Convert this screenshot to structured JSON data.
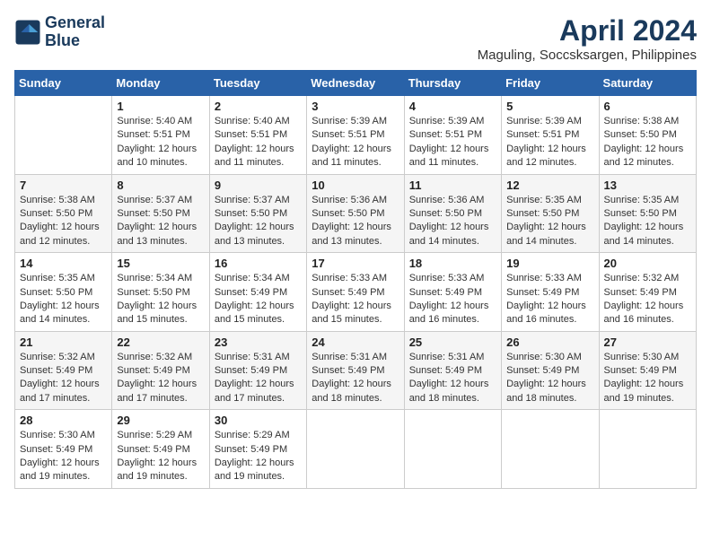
{
  "header": {
    "logo_line1": "General",
    "logo_line2": "Blue",
    "month_year": "April 2024",
    "location": "Maguling, Soccsksargen, Philippines"
  },
  "weekdays": [
    "Sunday",
    "Monday",
    "Tuesday",
    "Wednesday",
    "Thursday",
    "Friday",
    "Saturday"
  ],
  "weeks": [
    [
      {
        "day": null
      },
      {
        "day": 1,
        "sunrise": "5:40 AM",
        "sunset": "5:51 PM",
        "daylight": "12 hours and 10 minutes."
      },
      {
        "day": 2,
        "sunrise": "5:40 AM",
        "sunset": "5:51 PM",
        "daylight": "12 hours and 11 minutes."
      },
      {
        "day": 3,
        "sunrise": "5:39 AM",
        "sunset": "5:51 PM",
        "daylight": "12 hours and 11 minutes."
      },
      {
        "day": 4,
        "sunrise": "5:39 AM",
        "sunset": "5:51 PM",
        "daylight": "12 hours and 11 minutes."
      },
      {
        "day": 5,
        "sunrise": "5:39 AM",
        "sunset": "5:51 PM",
        "daylight": "12 hours and 12 minutes."
      },
      {
        "day": 6,
        "sunrise": "5:38 AM",
        "sunset": "5:50 PM",
        "daylight": "12 hours and 12 minutes."
      }
    ],
    [
      {
        "day": 7,
        "sunrise": "5:38 AM",
        "sunset": "5:50 PM",
        "daylight": "12 hours and 12 minutes."
      },
      {
        "day": 8,
        "sunrise": "5:37 AM",
        "sunset": "5:50 PM",
        "daylight": "12 hours and 13 minutes."
      },
      {
        "day": 9,
        "sunrise": "5:37 AM",
        "sunset": "5:50 PM",
        "daylight": "12 hours and 13 minutes."
      },
      {
        "day": 10,
        "sunrise": "5:36 AM",
        "sunset": "5:50 PM",
        "daylight": "12 hours and 13 minutes."
      },
      {
        "day": 11,
        "sunrise": "5:36 AM",
        "sunset": "5:50 PM",
        "daylight": "12 hours and 14 minutes."
      },
      {
        "day": 12,
        "sunrise": "5:35 AM",
        "sunset": "5:50 PM",
        "daylight": "12 hours and 14 minutes."
      },
      {
        "day": 13,
        "sunrise": "5:35 AM",
        "sunset": "5:50 PM",
        "daylight": "12 hours and 14 minutes."
      }
    ],
    [
      {
        "day": 14,
        "sunrise": "5:35 AM",
        "sunset": "5:50 PM",
        "daylight": "12 hours and 14 minutes."
      },
      {
        "day": 15,
        "sunrise": "5:34 AM",
        "sunset": "5:50 PM",
        "daylight": "12 hours and 15 minutes."
      },
      {
        "day": 16,
        "sunrise": "5:34 AM",
        "sunset": "5:49 PM",
        "daylight": "12 hours and 15 minutes."
      },
      {
        "day": 17,
        "sunrise": "5:33 AM",
        "sunset": "5:49 PM",
        "daylight": "12 hours and 15 minutes."
      },
      {
        "day": 18,
        "sunrise": "5:33 AM",
        "sunset": "5:49 PM",
        "daylight": "12 hours and 16 minutes."
      },
      {
        "day": 19,
        "sunrise": "5:33 AM",
        "sunset": "5:49 PM",
        "daylight": "12 hours and 16 minutes."
      },
      {
        "day": 20,
        "sunrise": "5:32 AM",
        "sunset": "5:49 PM",
        "daylight": "12 hours and 16 minutes."
      }
    ],
    [
      {
        "day": 21,
        "sunrise": "5:32 AM",
        "sunset": "5:49 PM",
        "daylight": "12 hours and 17 minutes."
      },
      {
        "day": 22,
        "sunrise": "5:32 AM",
        "sunset": "5:49 PM",
        "daylight": "12 hours and 17 minutes."
      },
      {
        "day": 23,
        "sunrise": "5:31 AM",
        "sunset": "5:49 PM",
        "daylight": "12 hours and 17 minutes."
      },
      {
        "day": 24,
        "sunrise": "5:31 AM",
        "sunset": "5:49 PM",
        "daylight": "12 hours and 18 minutes."
      },
      {
        "day": 25,
        "sunrise": "5:31 AM",
        "sunset": "5:49 PM",
        "daylight": "12 hours and 18 minutes."
      },
      {
        "day": 26,
        "sunrise": "5:30 AM",
        "sunset": "5:49 PM",
        "daylight": "12 hours and 18 minutes."
      },
      {
        "day": 27,
        "sunrise": "5:30 AM",
        "sunset": "5:49 PM",
        "daylight": "12 hours and 19 minutes."
      }
    ],
    [
      {
        "day": 28,
        "sunrise": "5:30 AM",
        "sunset": "5:49 PM",
        "daylight": "12 hours and 19 minutes."
      },
      {
        "day": 29,
        "sunrise": "5:29 AM",
        "sunset": "5:49 PM",
        "daylight": "12 hours and 19 minutes."
      },
      {
        "day": 30,
        "sunrise": "5:29 AM",
        "sunset": "5:49 PM",
        "daylight": "12 hours and 19 minutes."
      },
      {
        "day": null
      },
      {
        "day": null
      },
      {
        "day": null
      },
      {
        "day": null
      }
    ]
  ],
  "labels": {
    "sunrise": "Sunrise:",
    "sunset": "Sunset:",
    "daylight": "Daylight:"
  }
}
